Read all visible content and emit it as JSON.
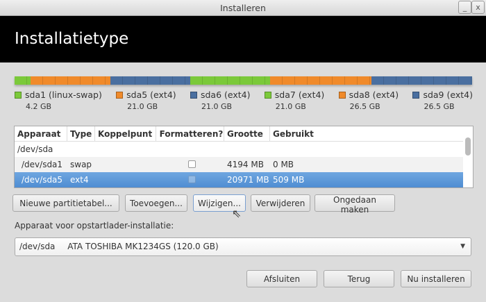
{
  "window": {
    "title": "Installeren",
    "minimize": "_",
    "close": "x"
  },
  "header": {
    "title": "Installatietype"
  },
  "partitions": [
    {
      "name": "sda1 (linux-swap)",
      "size": "4.2 GB",
      "gb": 4.2,
      "color": "#7bc93a"
    },
    {
      "name": "sda5 (ext4)",
      "size": "21.0 GB",
      "gb": 21.0,
      "color": "#f08a2a"
    },
    {
      "name": "sda6 (ext4)",
      "size": "21.0 GB",
      "gb": 21.0,
      "color": "#4a6fa0"
    },
    {
      "name": "sda7 (ext4)",
      "size": "21.0 GB",
      "gb": 21.0,
      "color": "#7bc93a"
    },
    {
      "name": "sda8 (ext4)",
      "size": "26.5 GB",
      "gb": 26.5,
      "color": "#f08a2a"
    },
    {
      "name": "sda9 (ext4)",
      "size": "26.5 GB",
      "gb": 26.5,
      "color": "#4a6fa0"
    }
  ],
  "table": {
    "headers": [
      "Apparaat",
      "Type",
      "Koppelpunt",
      "Formatteren?",
      "Grootte",
      "Gebruikt"
    ],
    "rows": [
      {
        "device": "/dev/sda",
        "type": "",
        "mount": "",
        "size": "",
        "used": ""
      },
      {
        "device": "/dev/sda1",
        "type": "swap",
        "mount": "",
        "size": "4194 MB",
        "used": "0 MB"
      },
      {
        "device": "/dev/sda5",
        "type": "ext4",
        "mount": "",
        "size": "20971 MB",
        "used": "509 MB"
      }
    ]
  },
  "actions": {
    "new_table": "Nieuwe partitietabel...",
    "add": "Toevoegen...",
    "change": "Wijzigen...",
    "delete": "Verwijderen",
    "undo": "Ongedaan maken"
  },
  "bootloader": {
    "label": "Apparaat voor opstartlader-installatie:",
    "device": "/dev/sda",
    "description": "ATA TOSHIBA MK1234GS (120.0 GB)"
  },
  "footer": {
    "quit": "Afsluiten",
    "back": "Terug",
    "install": "Nu installeren"
  }
}
